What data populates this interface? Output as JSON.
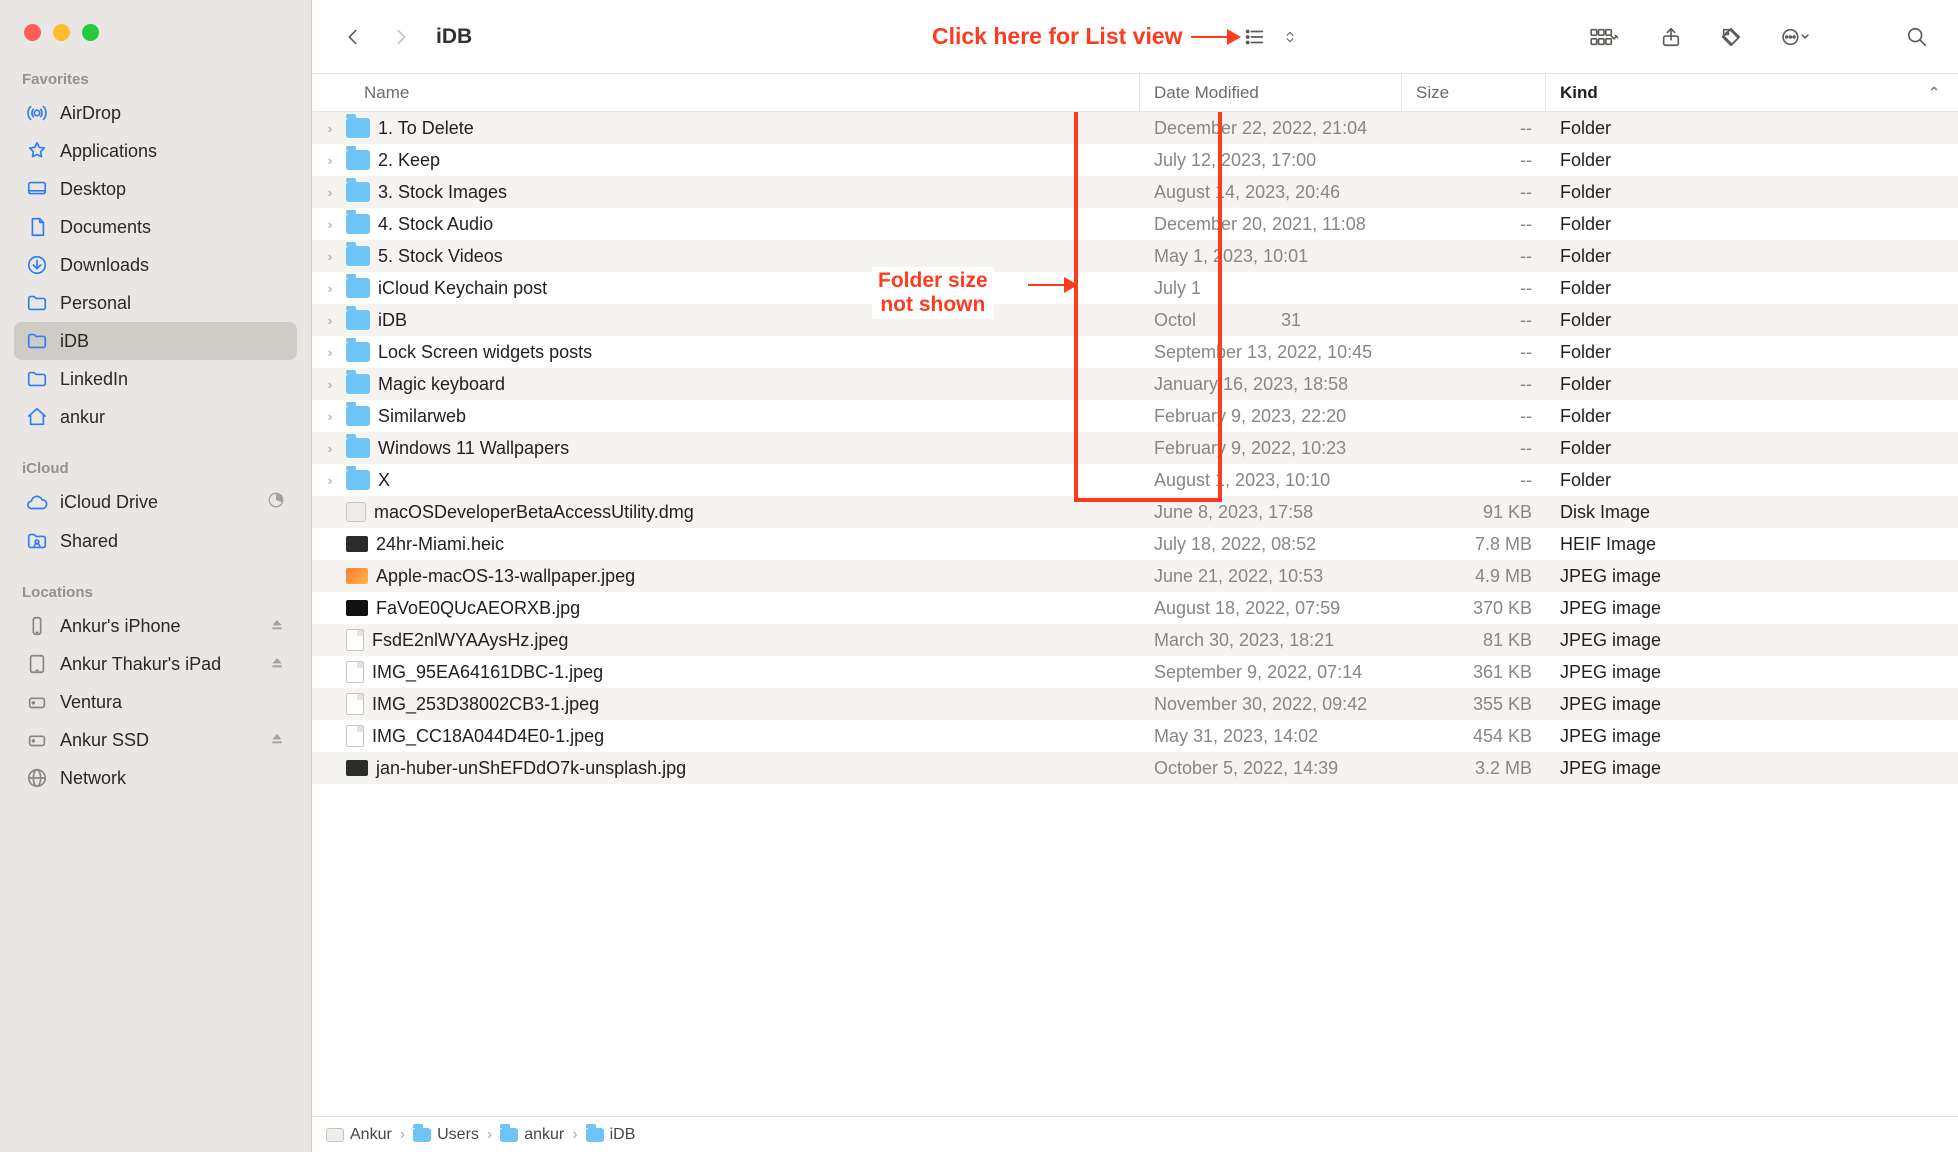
{
  "window_title": "iDB",
  "annotation_listview": "Click here for List view",
  "annotation_foldersize": "Folder size\nnot shown",
  "sidebar": {
    "sections": [
      {
        "title": "Favorites",
        "items": [
          {
            "icon": "airdrop",
            "label": "AirDrop"
          },
          {
            "icon": "app",
            "label": "Applications"
          },
          {
            "icon": "desktop",
            "label": "Desktop"
          },
          {
            "icon": "doc",
            "label": "Documents"
          },
          {
            "icon": "download",
            "label": "Downloads"
          },
          {
            "icon": "folder",
            "label": "Personal"
          },
          {
            "icon": "folder",
            "label": "iDB",
            "selected": true
          },
          {
            "icon": "folder",
            "label": "LinkedIn"
          },
          {
            "icon": "home",
            "label": "ankur"
          }
        ]
      },
      {
        "title": "iCloud",
        "items": [
          {
            "icon": "cloud",
            "label": "iCloud Drive",
            "trail": "pie"
          },
          {
            "icon": "shared",
            "label": "Shared"
          }
        ]
      },
      {
        "title": "Locations",
        "items": [
          {
            "icon": "phone",
            "label": "Ankur's iPhone",
            "trail": "eject"
          },
          {
            "icon": "ipad",
            "label": "Ankur Thakur's iPad",
            "trail": "eject"
          },
          {
            "icon": "hdd",
            "label": "Ventura"
          },
          {
            "icon": "hdd",
            "label": "Ankur SSD",
            "trail": "eject"
          },
          {
            "icon": "globe",
            "label": "Network"
          }
        ]
      }
    ]
  },
  "columns": {
    "name": "Name",
    "date": "Date Modified",
    "size": "Size",
    "kind": "Kind"
  },
  "rows": [
    {
      "name": "1. To Delete",
      "date": "December 22, 2022, 21:04",
      "size": "--",
      "kind": "Folder",
      "type": "folder"
    },
    {
      "name": "2. Keep",
      "date": "July 12, 2023, 17:00",
      "size": "--",
      "kind": "Folder",
      "type": "folder"
    },
    {
      "name": "3. Stock Images",
      "date": "August 14, 2023, 20:46",
      "size": "--",
      "kind": "Folder",
      "type": "folder"
    },
    {
      "name": "4. Stock Audio",
      "date": "December 20, 2021, 11:08",
      "size": "--",
      "kind": "Folder",
      "type": "folder"
    },
    {
      "name": "5. Stock Videos",
      "date": "May 1, 2023, 10:01",
      "size": "--",
      "kind": "Folder",
      "type": "folder"
    },
    {
      "name": "iCloud Keychain post",
      "date": "July 1",
      "size": "--",
      "kind": "Folder",
      "type": "folder"
    },
    {
      "name": "iDB",
      "date": "Octol",
      "size": "--",
      "kind": "Folder",
      "type": "folder",
      "date_obscured": "31"
    },
    {
      "name": "Lock Screen widgets posts",
      "date": "September 13, 2022, 10:45",
      "size": "--",
      "kind": "Folder",
      "type": "folder"
    },
    {
      "name": "Magic keyboard",
      "date": "January 16, 2023, 18:58",
      "size": "--",
      "kind": "Folder",
      "type": "folder"
    },
    {
      "name": "Similarweb",
      "date": "February 9, 2023, 22:20",
      "size": "--",
      "kind": "Folder",
      "type": "folder"
    },
    {
      "name": "Windows 11 Wallpapers",
      "date": "February 9, 2022, 10:23",
      "size": "--",
      "kind": "Folder",
      "type": "folder"
    },
    {
      "name": "X",
      "date": "August 1, 2023, 10:10",
      "size": "--",
      "kind": "Folder",
      "type": "folder"
    },
    {
      "name": "macOSDeveloperBetaAccessUtility.dmg",
      "date": "June 8, 2023, 17:58",
      "size": "91 KB",
      "kind": "Disk Image",
      "type": "disk"
    },
    {
      "name": "24hr-Miami.heic",
      "date": "July 18, 2022, 08:52",
      "size": "7.8 MB",
      "kind": "HEIF Image",
      "type": "img-dark"
    },
    {
      "name": "Apple-macOS-13-wallpaper.jpeg",
      "date": "June 21, 2022, 10:53",
      "size": "4.9 MB",
      "kind": "JPEG image",
      "type": "img-orange"
    },
    {
      "name": "FaVoE0QUcAEORXB.jpg",
      "date": "August 18, 2022, 07:59",
      "size": "370 KB",
      "kind": "JPEG image",
      "type": "img-black"
    },
    {
      "name": "FsdE2nlWYAAysHz.jpeg",
      "date": "March 30, 2023, 18:21",
      "size": "81 KB",
      "kind": "JPEG image",
      "type": "doc"
    },
    {
      "name": "IMG_95EA64161DBC-1.jpeg",
      "date": "September 9, 2022, 07:14",
      "size": "361 KB",
      "kind": "JPEG image",
      "type": "doc"
    },
    {
      "name": "IMG_253D38002CB3-1.jpeg",
      "date": "November 30, 2022, 09:42",
      "size": "355 KB",
      "kind": "JPEG image",
      "type": "doc"
    },
    {
      "name": "IMG_CC18A044D4E0-1.jpeg",
      "date": "May 31, 2023, 14:02",
      "size": "454 KB",
      "kind": "JPEG image",
      "type": "doc"
    },
    {
      "name": "jan-huber-unShEFDdO7k-unsplash.jpg",
      "date": "October 5, 2022, 14:39",
      "size": "3.2 MB",
      "kind": "JPEG image",
      "type": "img-dark"
    }
  ],
  "pathbar": [
    "Ankur",
    "Users",
    "ankur",
    "iDB"
  ]
}
